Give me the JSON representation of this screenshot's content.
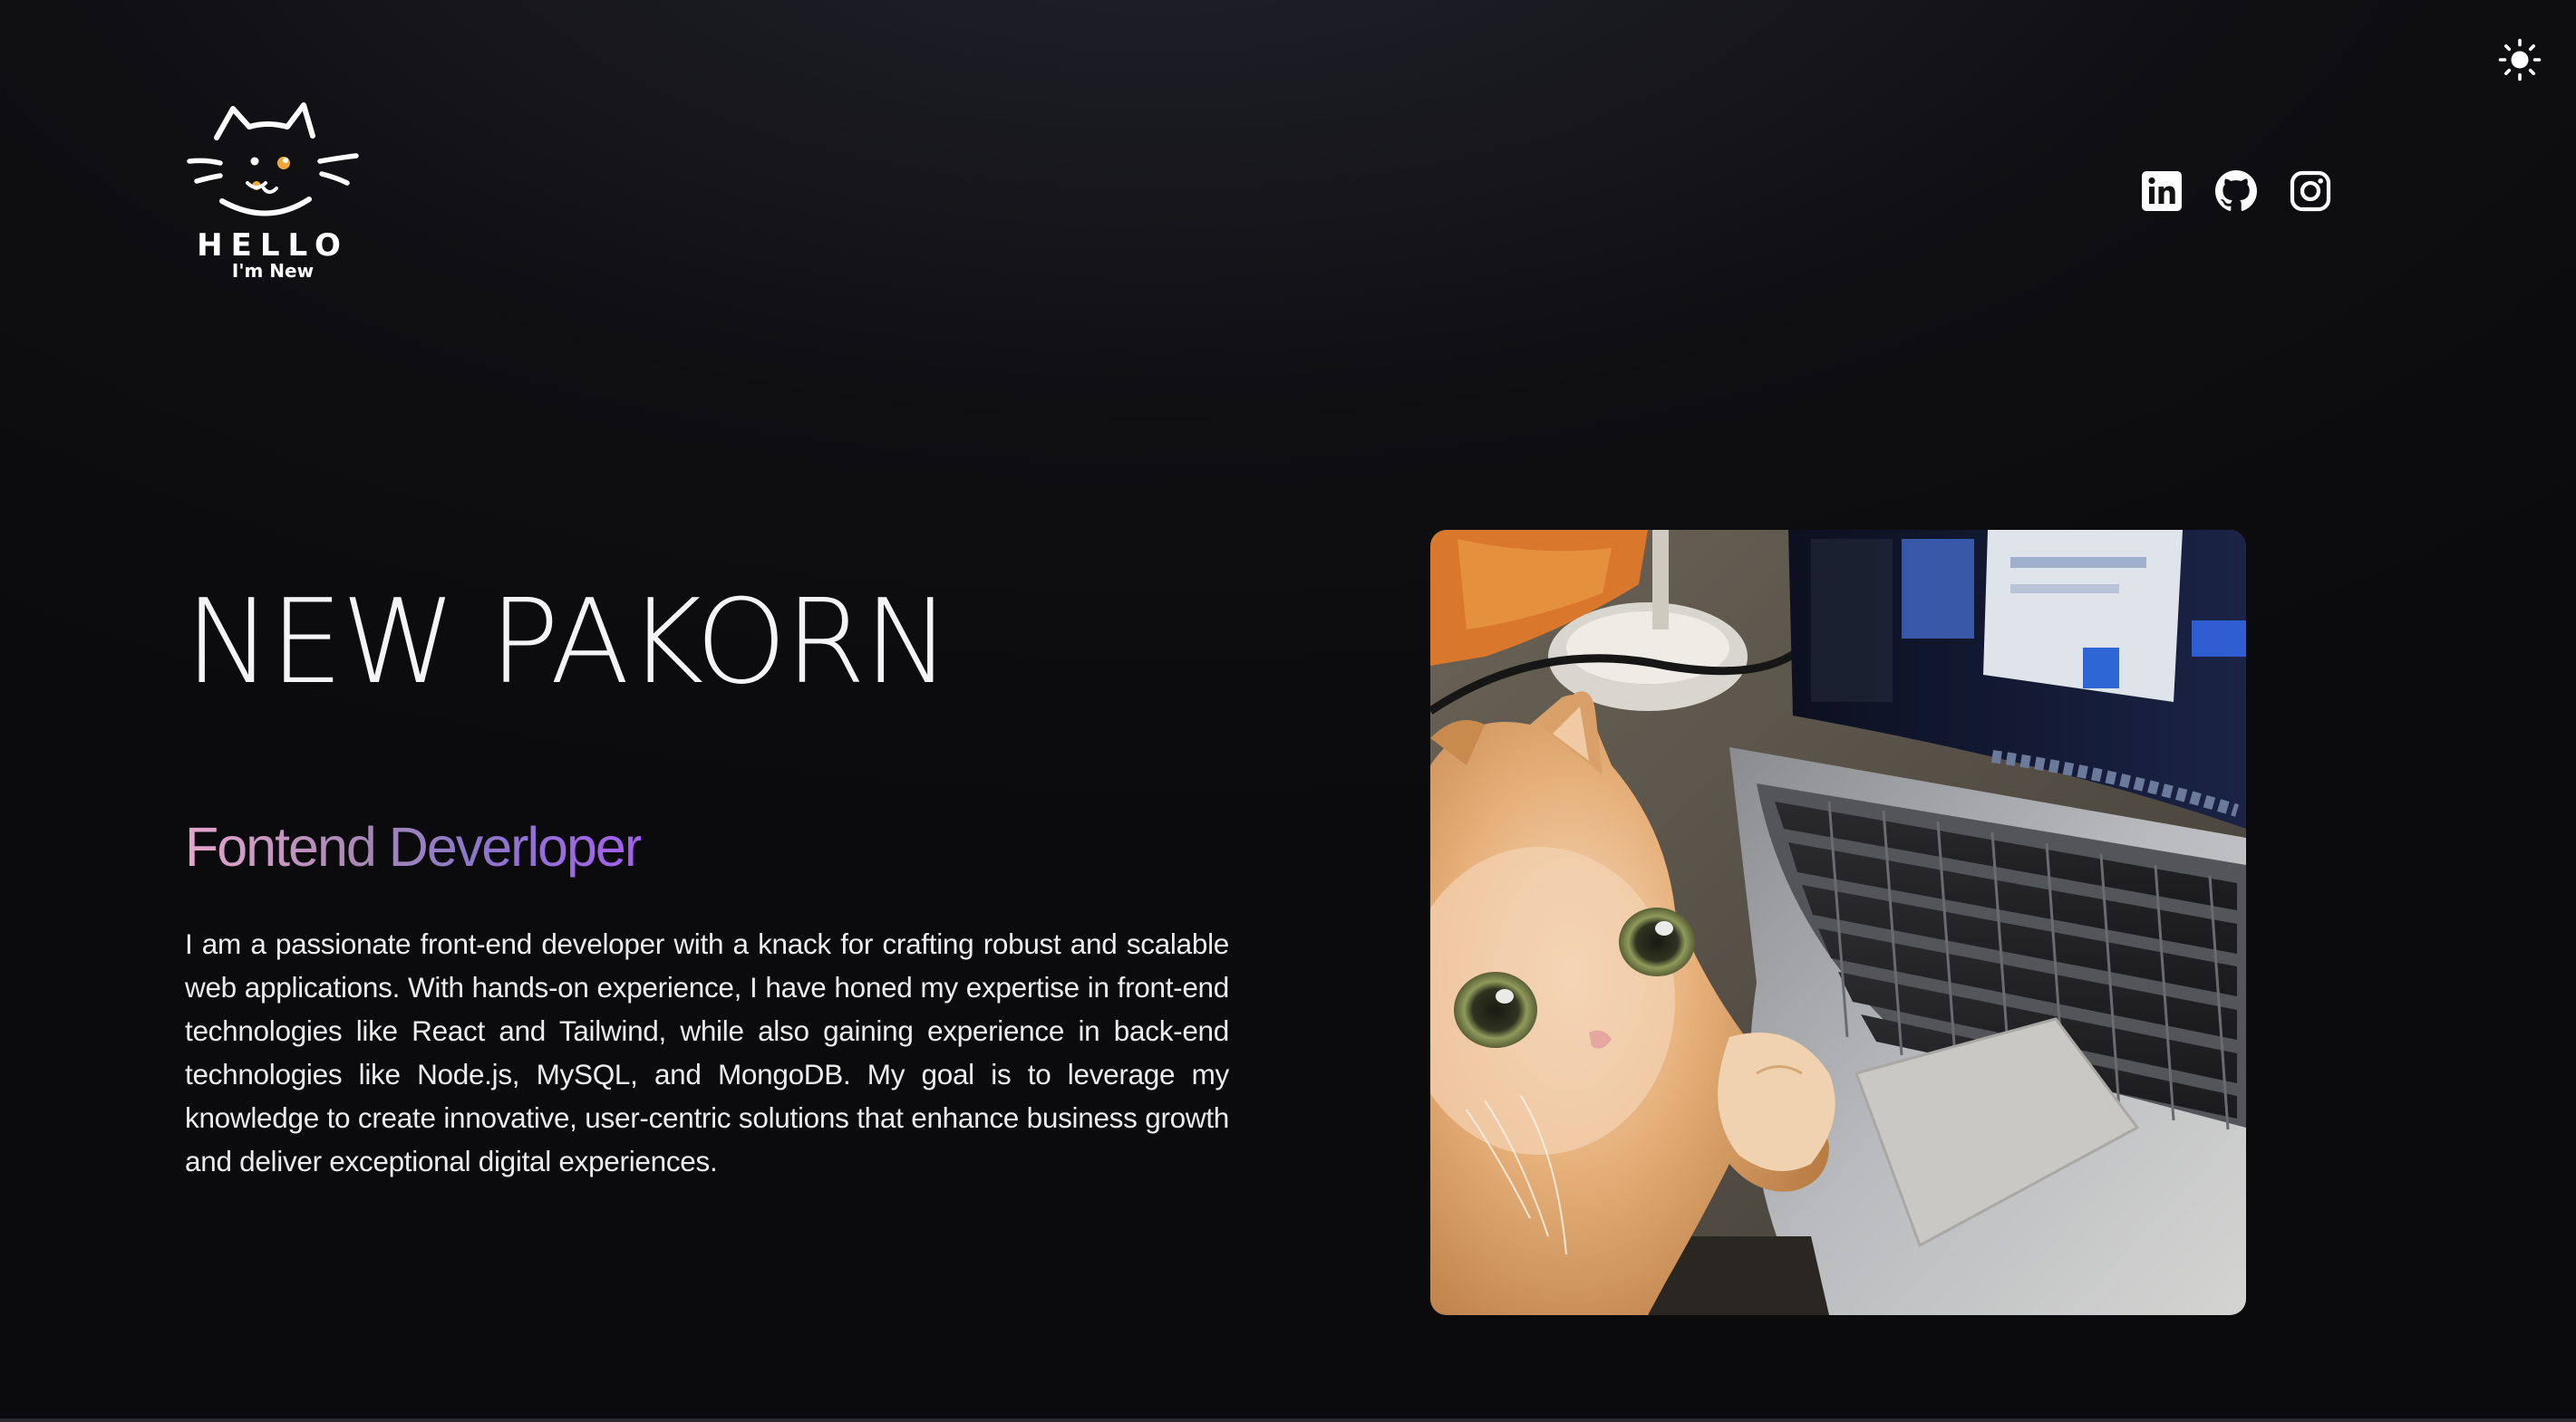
{
  "theme_toggle": {
    "icon": "sun-icon"
  },
  "logo": {
    "icon": "cat-face-icon",
    "line1": "HELLO",
    "line2": "I'm New"
  },
  "socials": [
    {
      "icon": "linkedin-icon"
    },
    {
      "icon": "github-icon"
    },
    {
      "icon": "instagram-icon"
    }
  ],
  "hero": {
    "name": "NEW PAKORN",
    "role": "Fontend Deverloper",
    "description": "I am a passionate front-end developer with a knack for crafting robust and scalable web applications. With hands-on experience, I have honed my expertise in front-end technologies like React and Tailwind, while also gaining experience in back-end technologies like Node.js, MySQL, and MongoDB. My goal is to leverage my knowledge to create innovative, user-centric solutions that enhance business growth and deliver exceptional digital experiences."
  },
  "colors": {
    "background": "#0b0b0d",
    "role_gradient_start": "#e6a6cc",
    "role_gradient_end": "#a45ff0",
    "text": "#ffffff"
  }
}
